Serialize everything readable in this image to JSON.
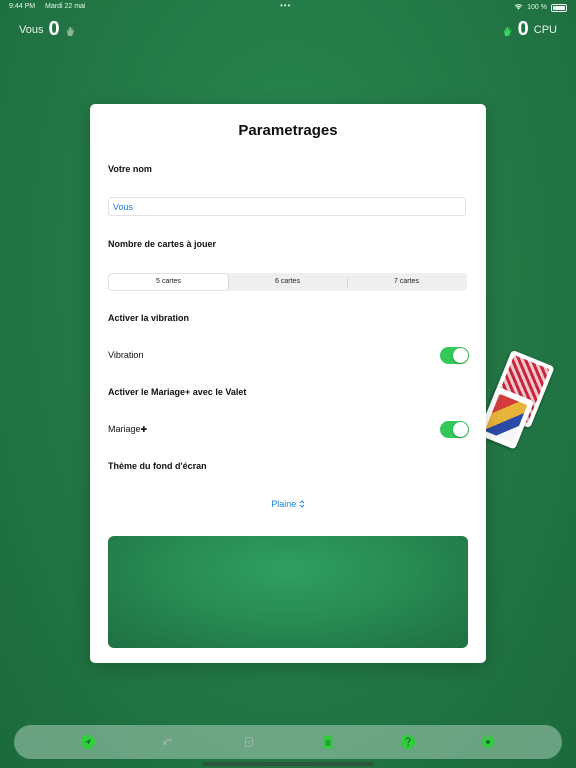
{
  "status_bar": {
    "time": "9:44 PM",
    "date": "Mardi 22 mai",
    "dots": "•••",
    "battery": "100 %"
  },
  "scores": {
    "you": {
      "name": "Vous",
      "value": "0"
    },
    "cpu": {
      "name": "CPU",
      "value": "0"
    }
  },
  "settings": {
    "title": "Parametrages",
    "name_section": "Votre nom",
    "name_value": "Vous",
    "cards_section": "Nombre de cartes à jouer",
    "card_options": [
      "5 cartes",
      "6 cartes",
      "7 cartes"
    ],
    "selected_option": "5 cartes",
    "vibration_section": "Activer la vibration",
    "vibration_label": "Vibration",
    "vibration_on": true,
    "mariage_section": "Activer le Mariage+ avec le Valet",
    "mariage_label": "Mariage",
    "mariage_plus": "✚",
    "mariage_on": true,
    "theme_section": "Thème du fond d'écran",
    "theme_value": "Plaine",
    "theme_chevron": "⌃⌄"
  },
  "toolbar": {
    "icons": [
      "send-icon",
      "undo-icon",
      "list-icon",
      "document-icon",
      "help-icon",
      "gear-icon"
    ]
  },
  "colors": {
    "accent": "#34c759",
    "link": "#1f7fe0",
    "background": "#237a47"
  }
}
